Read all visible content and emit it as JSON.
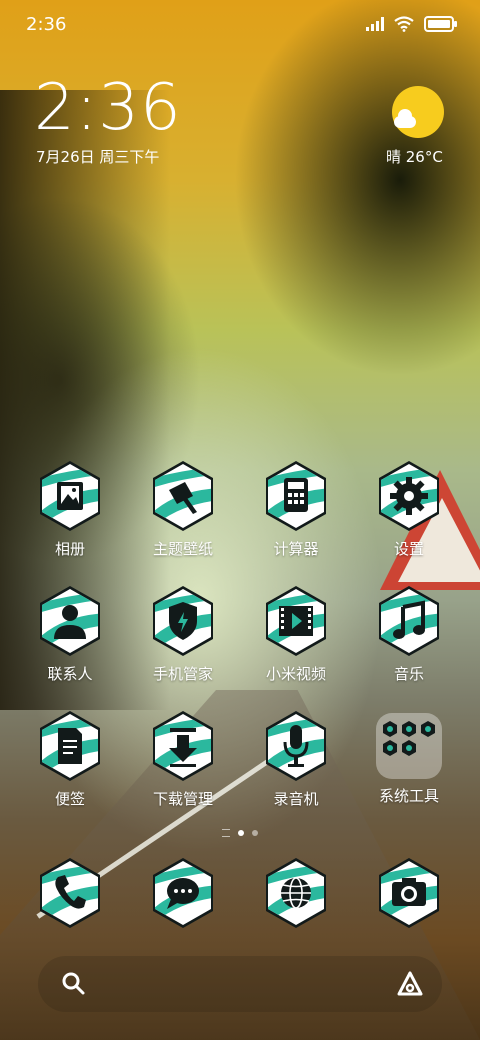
{
  "status_bar": {
    "time": "2:36",
    "signal_icon": "signal-icon",
    "wifi_icon": "wifi-icon",
    "battery_icon": "battery-icon"
  },
  "clock_widget": {
    "time": "2:36",
    "date": "7月26日 周三下午"
  },
  "weather_widget": {
    "icon": "sunny-cloud-icon",
    "text": "晴 26°C"
  },
  "colors": {
    "icon_teal": "#2bb89e",
    "icon_dark": "#121a1a",
    "sun": "#f7cc1e"
  },
  "apps": [
    {
      "label": "相册",
      "icon": "gallery-icon"
    },
    {
      "label": "主题壁纸",
      "icon": "theme-brush-icon"
    },
    {
      "label": "计算器",
      "icon": "calculator-icon"
    },
    {
      "label": "设置",
      "icon": "gear-icon"
    },
    {
      "label": "联系人",
      "icon": "contact-person-icon"
    },
    {
      "label": "手机管家",
      "icon": "security-shield-icon"
    },
    {
      "label": "小米视频",
      "icon": "video-play-icon"
    },
    {
      "label": "音乐",
      "icon": "music-note-icon"
    },
    {
      "label": "便签",
      "icon": "notes-icon"
    },
    {
      "label": "下载管理",
      "icon": "download-icon"
    },
    {
      "label": "录音机",
      "icon": "microphone-icon"
    },
    {
      "label": "系统工具",
      "icon": "folder-icon"
    }
  ],
  "dock": [
    {
      "icon": "phone-icon"
    },
    {
      "icon": "messages-icon"
    },
    {
      "icon": "browser-globe-icon"
    },
    {
      "icon": "camera-icon"
    }
  ],
  "page_indicator": {
    "pages": 2,
    "current": 1
  },
  "search_bar": {
    "search_icon": "search-icon",
    "assistant_icon": "assistant-icon"
  }
}
